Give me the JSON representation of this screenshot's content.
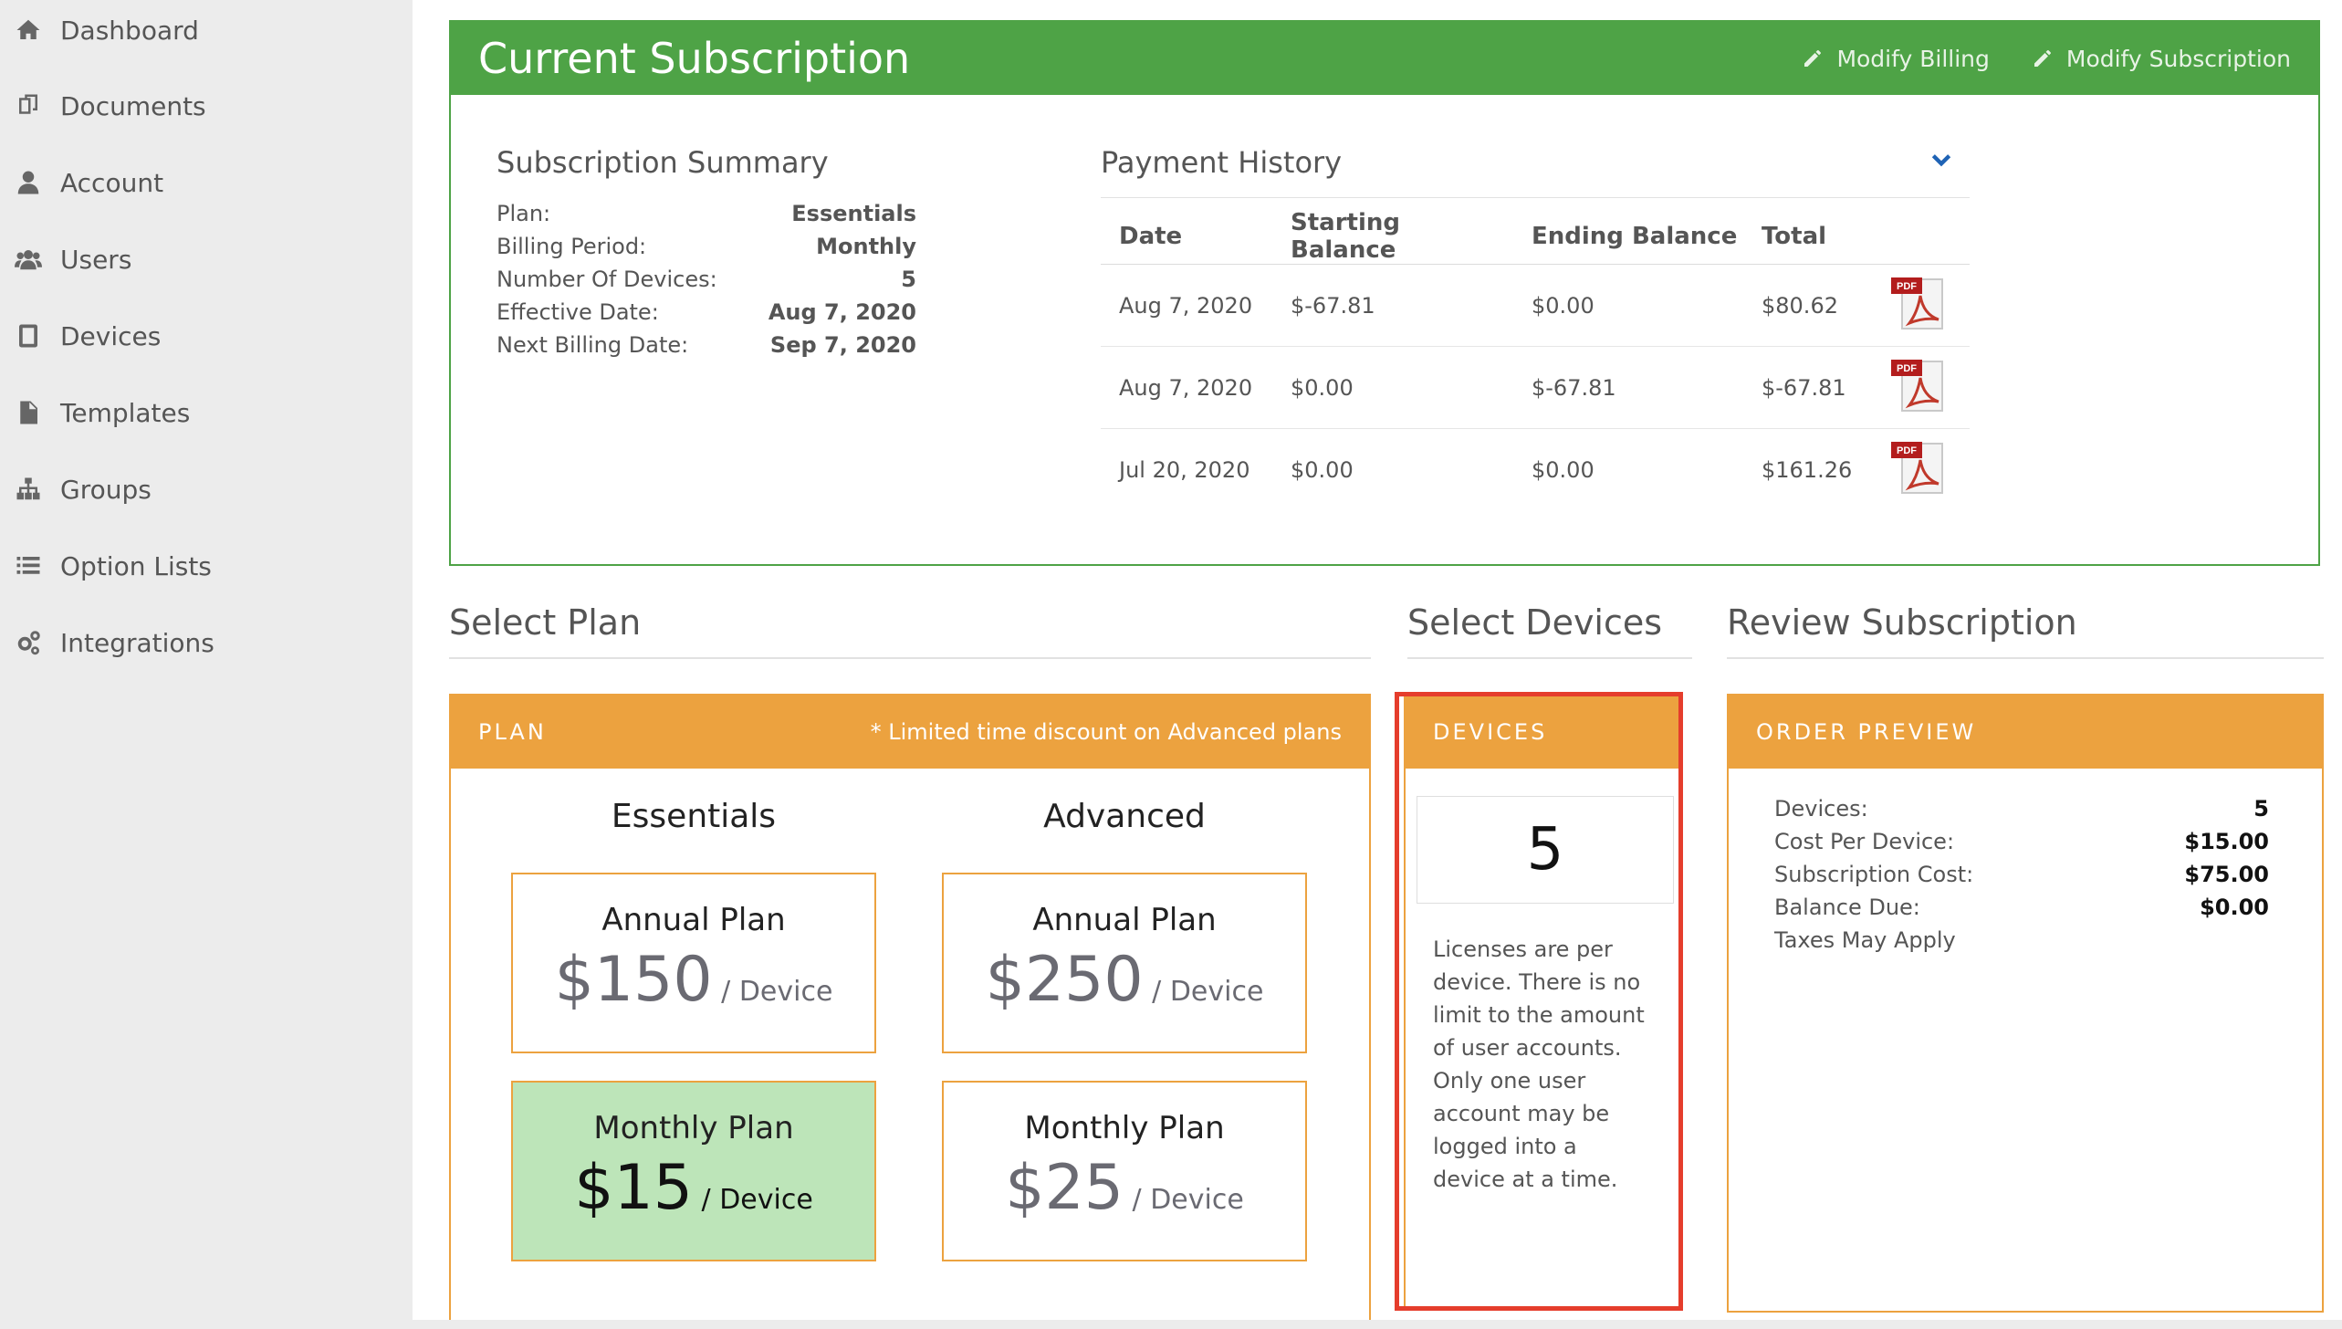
{
  "sidebar": {
    "items": [
      {
        "label": "Dashboard",
        "icon": "home-icon"
      },
      {
        "label": "Documents",
        "icon": "documents-icon"
      },
      {
        "label": "Account",
        "icon": "user-icon"
      },
      {
        "label": "Users",
        "icon": "users-icon"
      },
      {
        "label": "Devices",
        "icon": "tablet-icon"
      },
      {
        "label": "Templates",
        "icon": "file-icon"
      },
      {
        "label": "Groups",
        "icon": "sitemap-icon"
      },
      {
        "label": "Option Lists",
        "icon": "list-icon"
      },
      {
        "label": "Integrations",
        "icon": "gears-icon"
      }
    ]
  },
  "current": {
    "title": "Current Subscription",
    "modify_billing": "Modify Billing",
    "modify_subscription": "Modify Subscription"
  },
  "summary": {
    "title": "Subscription Summary",
    "rows": [
      {
        "label": "Plan:",
        "value": "Essentials"
      },
      {
        "label": "Billing Period:",
        "value": "Monthly"
      },
      {
        "label": "Number Of Devices:",
        "value": "5"
      },
      {
        "label": "Effective Date:",
        "value": "Aug 7, 2020"
      },
      {
        "label": "Next Billing Date:",
        "value": "Sep 7, 2020"
      }
    ]
  },
  "payment_history": {
    "title": "Payment History",
    "columns": [
      "Date",
      "Starting Balance",
      "Ending Balance",
      "Total"
    ],
    "rows": [
      {
        "date": "Aug 7, 2020",
        "start": "$-67.81",
        "end": "$0.00",
        "total": "$80.62",
        "pdf": "PDF"
      },
      {
        "date": "Aug 7, 2020",
        "start": "$0.00",
        "end": "$-67.81",
        "total": "$-67.81",
        "pdf": "PDF"
      },
      {
        "date": "Jul 20, 2020",
        "start": "$0.00",
        "end": "$0.00",
        "total": "$161.26",
        "pdf": "PDF"
      }
    ]
  },
  "sections": {
    "select_plan": "Select Plan",
    "select_devices": "Select Devices",
    "review_subscription": "Review Subscription"
  },
  "plan_panel": {
    "header": "PLAN",
    "note": "* Limited time discount on Advanced plans",
    "essentials_title": "Essentials",
    "advanced_title": "Advanced",
    "essentials_annual": {
      "name": "Annual Plan",
      "price": "$150",
      "unit": "/ Device"
    },
    "essentials_monthly": {
      "name": "Monthly Plan",
      "price": "$15",
      "unit": "/ Device"
    },
    "advanced_annual": {
      "name": "Annual Plan",
      "price": "$250",
      "unit": "/ Device"
    },
    "advanced_monthly": {
      "name": "Monthly Plan",
      "price": "$25",
      "unit": "/ Device"
    }
  },
  "devices_panel": {
    "header": "DEVICES",
    "count": "5",
    "note": "Licenses are per device. There is no limit to the amount of user accounts. Only one user account may be logged into a device at a time."
  },
  "order_preview": {
    "header": "ORDER PREVIEW",
    "rows": [
      {
        "label": "Devices:",
        "value": "5"
      },
      {
        "label": "Cost Per Device:",
        "value": "$15.00"
      },
      {
        "label": "Subscription Cost:",
        "value": "$75.00"
      },
      {
        "label": "Balance Due:",
        "value": "$0.00"
      },
      {
        "label": "Taxes May Apply",
        "value": ""
      }
    ]
  },
  "colors": {
    "green": "#4ea346",
    "orange": "#eca23f",
    "selected_plan": "#bde5b9",
    "highlight_red": "#e53d2c",
    "link_blue": "#1f63b5"
  }
}
